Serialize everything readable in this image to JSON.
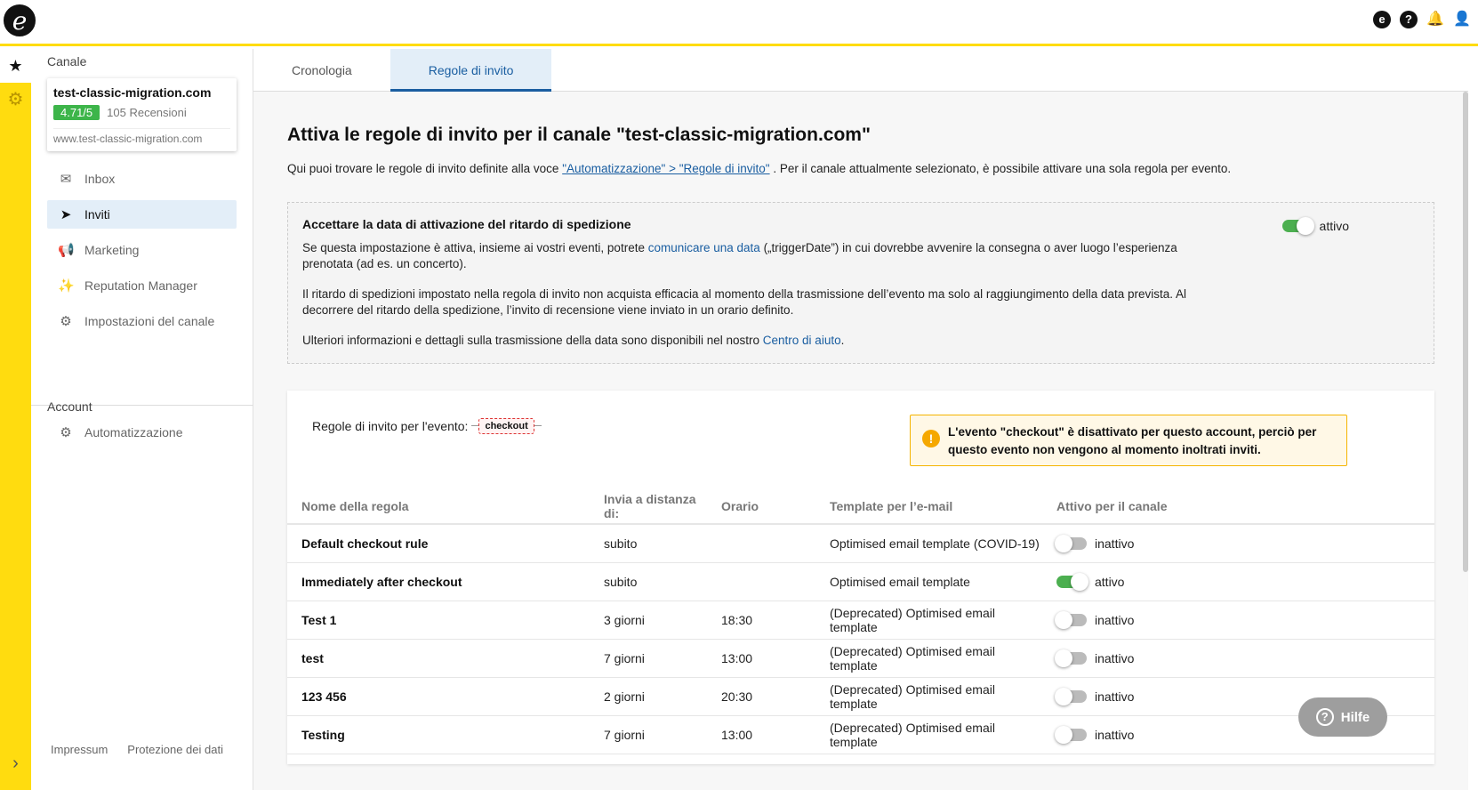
{
  "header": {
    "logo_glyph": "e",
    "icons": [
      "etrusted-icon",
      "help-icon",
      "bell-icon",
      "user-icon"
    ],
    "icon_glyphs": [
      "e",
      "?",
      "🔔",
      "👤"
    ]
  },
  "rail": {
    "star_glyph": "★",
    "gear_glyph": "⚙",
    "expand_glyph": "›"
  },
  "sidebar": {
    "channel_label": "Canale",
    "channel": {
      "name": "test-classic-migration.com",
      "rating": "4.71/5",
      "reviews": "105 Recensioni",
      "url": "www.test-classic-migration.com"
    },
    "nav": [
      {
        "label": "Inbox",
        "icon": "inbox-icon",
        "glyph": "✉"
      },
      {
        "label": "Inviti",
        "icon": "paper-plane-icon",
        "glyph": "➤"
      },
      {
        "label": "Marketing",
        "icon": "megaphone-icon",
        "glyph": "📢"
      },
      {
        "label": "Reputation Manager",
        "icon": "sparkle-icon",
        "glyph": "✨"
      },
      {
        "label": "Impostazioni del canale",
        "icon": "gear-icon",
        "glyph": "⚙"
      }
    ],
    "account_label": "Account",
    "account_nav": [
      {
        "label": "Automatizzazione",
        "icon": "robot-icon",
        "glyph": "⚙"
      }
    ],
    "footer": {
      "impressum": "Impressum",
      "privacy": "Protezione dei dati"
    }
  },
  "tabs": [
    {
      "label": "Cronologia",
      "active": false
    },
    {
      "label": "Regole di invito",
      "active": true
    }
  ],
  "main": {
    "title": "Attiva le regole di invito per il canale \"test-classic-migration.com\"",
    "intro_before": "Qui puoi trovare le regole di invito definite alla voce ",
    "intro_link": "\"Automatizzazione\" > \"Regole di invito\"",
    "intro_after": " . Per il canale attualmente selezionato, è possibile attivare una sola regola per evento.",
    "info": {
      "heading": "Accettare la data di attivazione del ritardo di spedizione",
      "toggle_label": "attivo",
      "p1_before": "Se questa impostazione è attiva, insieme ai vostri eventi, potrete ",
      "p1_link": "comunicare una data",
      "p1_after": " („triggerDate”) in cui dovrebbe avvenire la consegna o aver luogo l’esperienza prenotata (ad es. un concerto).",
      "p2": "Il ritardo di spedizioni impostato nella regola di invito non acquista efficacia al momento della trasmissione dell’evento ma solo al raggiungimento della data prevista. Al decorrere del ritardo della spedizione, l’invito di recensione viene inviato in un orario definito.",
      "p3_before": "Ulteriori informazioni e dettagli sulla trasmissione della data sono disponibili nel nostro ",
      "p3_link": "Centro di aiuto",
      "p3_after": "."
    },
    "rules": {
      "event_label": "Regole di invito per l'evento:",
      "event_tag": "checkout",
      "warning": "L'evento \"checkout\" è disattivato per questo account, perciò per questo evento non vengono al momento inoltrati inviti.",
      "columns": [
        "Nome della regola",
        "Invia a distanza di:",
        "Orario",
        "Template per l’e-mail",
        "Attivo per il canale"
      ],
      "rows": [
        {
          "name": "Default checkout rule",
          "delay": "subito",
          "time": "",
          "template": "Optimised email template (COVID-19)",
          "status": "inattivo",
          "active": false
        },
        {
          "name": "Immediately after checkout",
          "delay": "subito",
          "time": "",
          "template": "Optimised email template",
          "status": "attivo",
          "active": true
        },
        {
          "name": "Test 1",
          "delay": "3 giorni",
          "time": "18:30",
          "template": "(Deprecated) Optimised email template",
          "status": "inattivo",
          "active": false
        },
        {
          "name": "test",
          "delay": "7 giorni",
          "time": "13:00",
          "template": "(Deprecated) Optimised email template",
          "status": "inattivo",
          "active": false
        },
        {
          "name": "123 456",
          "delay": "2 giorni",
          "time": "20:30",
          "template": "(Deprecated) Optimised email template",
          "status": "inattivo",
          "active": false
        },
        {
          "name": "Testing",
          "delay": "7 giorni",
          "time": "13:00",
          "template": "(Deprecated) Optimised email template",
          "status": "inattivo",
          "active": false
        }
      ]
    }
  },
  "help_button": {
    "label": "Hilfe",
    "glyph": "?"
  },
  "colors": {
    "accent_yellow": "#ffdc0f",
    "link_blue": "#1a5ea1",
    "rating_green": "#3db54a",
    "toggle_on": "#4caf50",
    "warning_orange": "#f5a800"
  }
}
